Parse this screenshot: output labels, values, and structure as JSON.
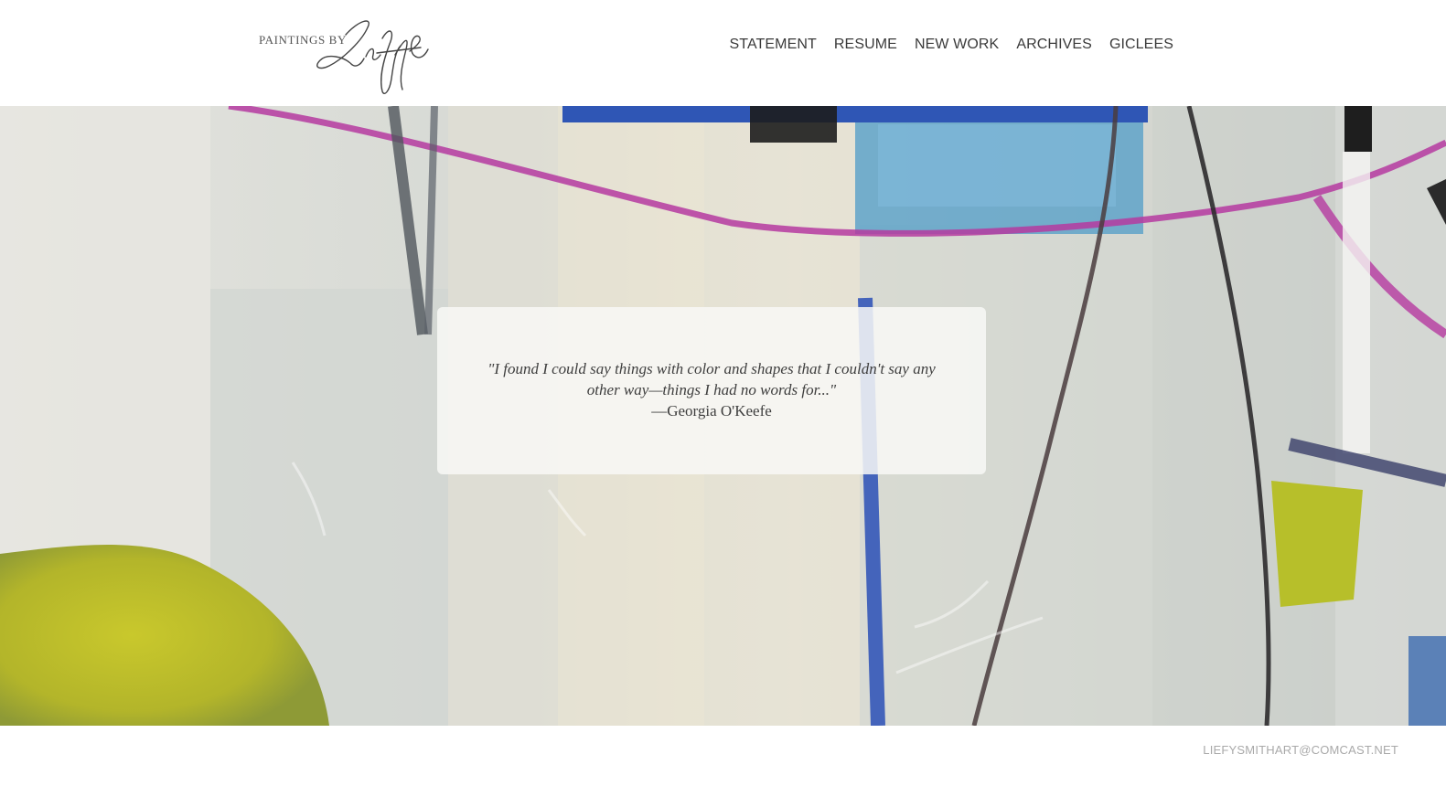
{
  "header": {
    "logo": {
      "prefix": "PAINTINGS BY",
      "signature": "Liefje"
    },
    "nav": [
      {
        "label": "STATEMENT"
      },
      {
        "label": "RESUME"
      },
      {
        "label": "NEW WORK"
      },
      {
        "label": "ARCHIVES"
      },
      {
        "label": "GICLEES"
      }
    ]
  },
  "hero": {
    "background_icon": "abstract-painting-image",
    "quote": {
      "text": "\"I found I could say things with color and shapes that I couldn't say any other way—things I had no words for...\"",
      "author": "—Georgia O'Keefe"
    }
  },
  "footer": {
    "email": "LIEFYSMITHART@COMCAST.NET"
  },
  "colors": {
    "nav_text": "#3a3a3a",
    "footer_text": "#a9a9a9",
    "accent_magenta": "#b53aa0",
    "accent_blue": "#3456b8",
    "accent_yellow_green": "#b7bf2a"
  }
}
